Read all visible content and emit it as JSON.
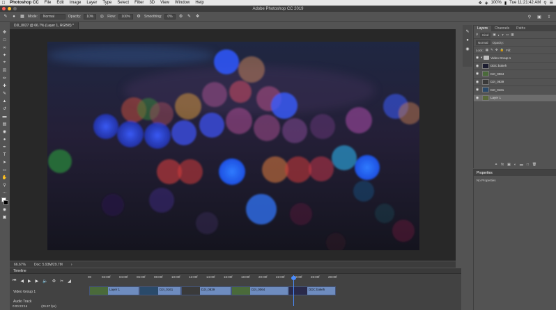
{
  "menubar": {
    "app": "Photoshop CC",
    "items": [
      "File",
      "Edit",
      "Image",
      "Layer",
      "Type",
      "Select",
      "Filter",
      "3D",
      "View",
      "Window",
      "Help"
    ],
    "battery": "100%",
    "clock": "Tue 11:21:42 AM"
  },
  "window": {
    "title": "Adobe Photoshop CC 2019"
  },
  "options": {
    "mode_label": "Mode:",
    "mode_value": "Normal",
    "opacity_label": "Opacity:",
    "opacity_value": "10%",
    "flow_label": "Flow:",
    "flow_value": "100%",
    "smoothing_label": "Smoothing:",
    "smoothing_value": "0%"
  },
  "document": {
    "tab": "DJI_0027 @ 66.7% (Layer 1, RGB/8) *",
    "zoom": "66.67%",
    "doc_size": "Doc: 5.93M/29.7M"
  },
  "timeline": {
    "title": "Timeline",
    "ruler": [
      "00",
      "02:00f",
      "04:00f",
      "06:00f",
      "08:00f",
      "10:00f",
      "12:00f",
      "14:00f",
      "16:00f",
      "18:00f",
      "20:00f",
      "22:00f",
      "24:00f",
      "26:00f",
      "28:00f"
    ],
    "video_group": "Video Group 1",
    "audio_track": "Audio Track",
    "clips": [
      "Layer 1",
      "DJI_0161",
      "DJI_0839",
      "DJI_0064",
      "DDC bokeh"
    ],
    "timecode": "0:00:23:16",
    "fps": "(29.97 fps)"
  },
  "layers_panel": {
    "tabs": [
      "Layers",
      "Channels",
      "Paths"
    ],
    "kind": "Kind",
    "blend": "Normal",
    "opacity": "Opacity:",
    "lock": "Lock:",
    "fill": "Fill:",
    "layers": [
      {
        "name": "Video Group 1",
        "type": "group"
      },
      {
        "name": "DDC bokeh",
        "type": "video"
      },
      {
        "name": "DJI_0064",
        "type": "video"
      },
      {
        "name": "DJI_0839",
        "type": "video"
      },
      {
        "name": "DJI_0161",
        "type": "video"
      },
      {
        "name": "Layer 1",
        "type": "video"
      }
    ]
  },
  "properties": {
    "title": "Properties",
    "body": "No Properties"
  }
}
